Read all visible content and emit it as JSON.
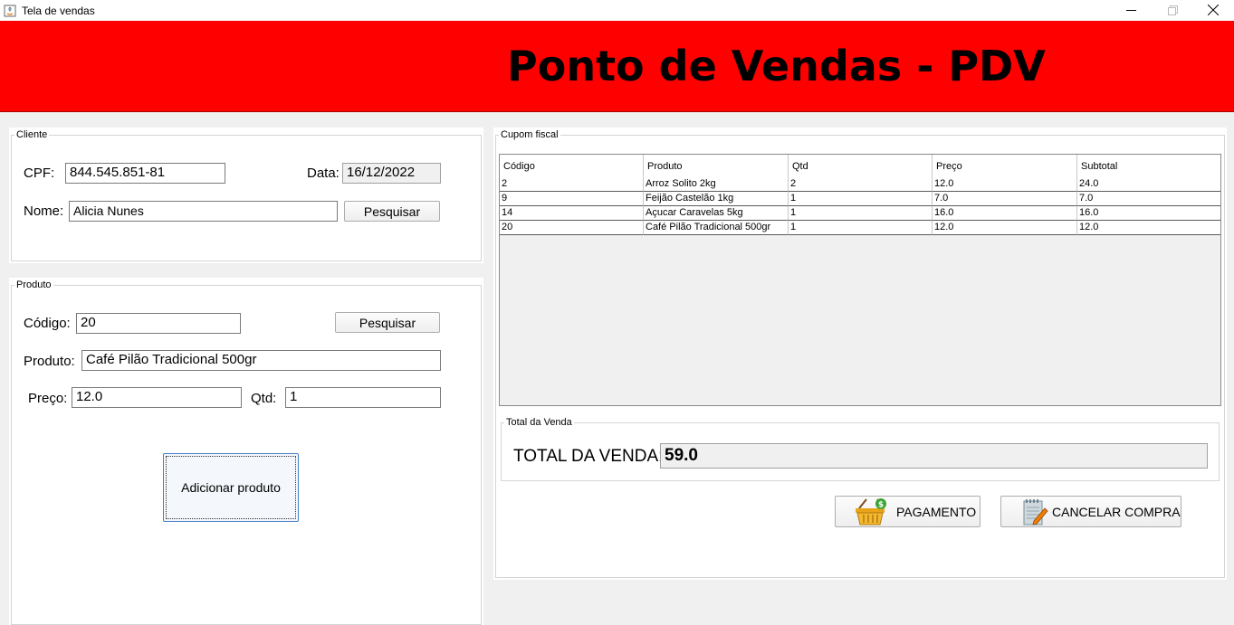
{
  "window": {
    "title": "Tela de vendas",
    "app_icon": "java-icon"
  },
  "header": {
    "title": "Ponto de Vendas - PDV",
    "background": "#ff0000"
  },
  "cliente": {
    "legend": "Cliente",
    "cpf_label": "CPF:",
    "cpf_value": "844.545.851-81",
    "data_label": "Data:",
    "data_value": "16/12/2022",
    "nome_label": "Nome:",
    "nome_value": "Alicia Nunes",
    "search_button": "Pesquisar"
  },
  "produto": {
    "legend": "Produto",
    "codigo_label": "Código:",
    "codigo_value": "20",
    "search_button": "Pesquisar",
    "produto_label": "Produto:",
    "produto_value": "Café Pilão Tradicional 500gr",
    "preco_label": "Preço:",
    "preco_value": "12.0",
    "qtd_label": "Qtd:",
    "qtd_value": "1",
    "add_button": "Adicionar produto"
  },
  "cupom": {
    "legend": "Cupom fiscal",
    "columns": [
      "Código",
      "Produto",
      "Qtd",
      "Preço",
      "Subtotal"
    ],
    "rows": [
      [
        "2",
        "Arroz Solito 2kg",
        "2",
        "12.0",
        "24.0"
      ],
      [
        "9",
        "Feijão Castelão 1kg",
        "1",
        "7.0",
        "7.0"
      ],
      [
        "14",
        "Açucar Caravelas 5kg",
        "1",
        "16.0",
        "16.0"
      ],
      [
        "20",
        "Café Pilão Tradicional 500gr",
        "1",
        "12.0",
        "12.0"
      ]
    ]
  },
  "total": {
    "legend": "Total da Venda",
    "label": "TOTAL DA VENDA:",
    "value": "59.0"
  },
  "actions": {
    "pagamento": {
      "label": "PAGAMENTO",
      "icon": "shopping-basket-icon"
    },
    "cancelar": {
      "label": "CANCELAR COMPRA",
      "icon": "notepad-pencil-icon"
    }
  }
}
